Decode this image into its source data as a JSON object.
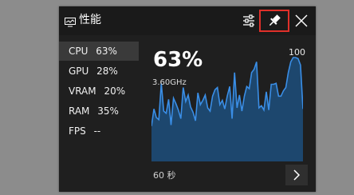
{
  "titlebar": {
    "title": "性能",
    "icons": {
      "app": "performance-monitor-icon",
      "settings": "sliders-icon",
      "pin": "pin-icon",
      "close": "close-icon"
    },
    "pin_highlight_color": "#e0302a"
  },
  "metrics": [
    {
      "name": "CPU",
      "value": "63%",
      "selected": true
    },
    {
      "name": "GPU",
      "value": "28%"
    },
    {
      "name": "VRAM",
      "value": "20%"
    },
    {
      "name": "RAM",
      "value": "35%"
    },
    {
      "name": "FPS",
      "value": "--"
    }
  ],
  "graph": {
    "current": "63%",
    "frequency": "3.60GHz",
    "max_label": "100",
    "time_label": "60 秒",
    "line_color": "#3a8ee6",
    "fill_color": "#1d4f7c",
    "points": [
      33,
      49,
      41,
      39,
      73,
      47,
      45,
      58,
      34,
      59,
      54,
      48,
      40,
      69,
      56,
      62,
      51,
      46,
      38,
      64,
      53,
      57,
      62,
      50,
      47,
      61,
      67,
      69,
      53,
      57,
      49,
      61,
      70,
      40,
      83,
      50,
      62,
      47,
      61,
      70,
      68,
      83,
      86,
      93,
      50,
      52,
      48,
      65,
      48,
      72,
      72,
      73,
      61,
      61,
      66,
      69,
      83,
      93,
      97,
      97,
      96,
      90,
      49
    ]
  },
  "next_button": {
    "icon": "chevron-right-icon"
  }
}
